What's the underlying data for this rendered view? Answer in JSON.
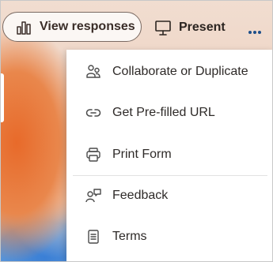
{
  "toolbar": {
    "view_responses_label": "View responses",
    "view_responses_icon": "bar-chart-icon",
    "present_label": "Present",
    "present_icon": "presentation-icon",
    "more_icon": "more-horizontal-icon"
  },
  "menu": {
    "items": [
      {
        "label": "Collaborate or Duplicate",
        "icon": "people-icon"
      },
      {
        "label": "Get Pre-filled URL",
        "icon": "link-icon"
      },
      {
        "label": "Print Form",
        "icon": "printer-icon"
      },
      {
        "label": "Feedback",
        "icon": "person-feedback-icon"
      },
      {
        "label": "Terms",
        "icon": "document-icon"
      }
    ]
  },
  "colors": {
    "menu_text": "#2e2a28",
    "button_border": "#7a6a62",
    "icon_color": "#4a4a4a"
  }
}
